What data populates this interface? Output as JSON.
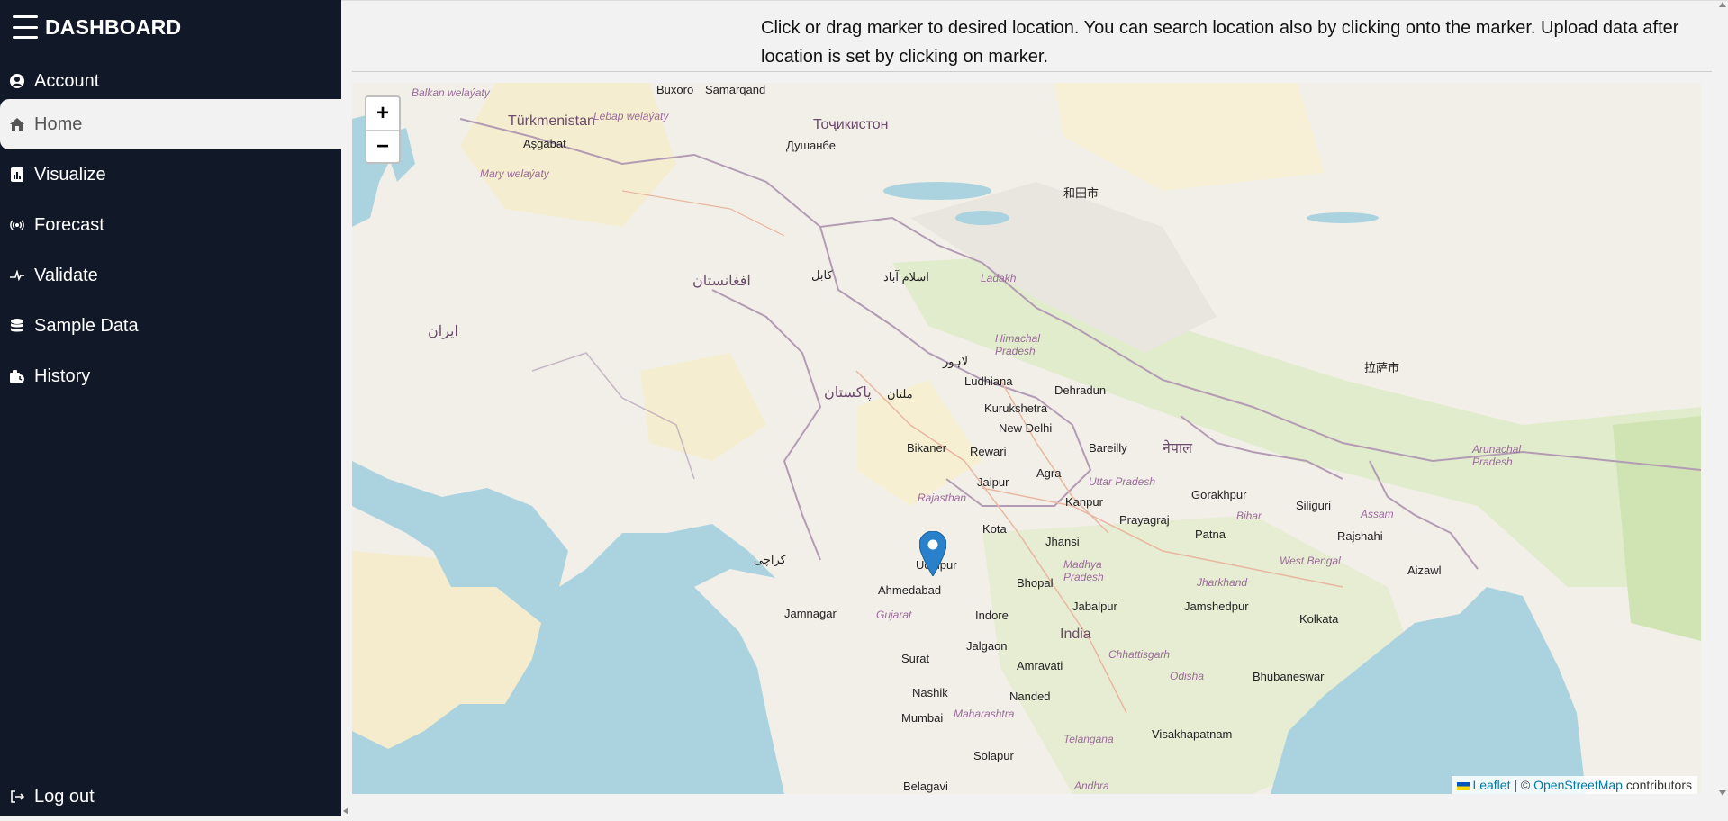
{
  "sidebar": {
    "title": "DASHBOARD",
    "items": [
      {
        "label": "Account",
        "icon": "account-icon"
      },
      {
        "label": "Home",
        "icon": "home-icon",
        "active": true
      },
      {
        "label": "Visualize",
        "icon": "chart-icon"
      },
      {
        "label": "Forecast",
        "icon": "broadcast-icon"
      },
      {
        "label": "Validate",
        "icon": "validate-icon"
      },
      {
        "label": "Sample Data",
        "icon": "database-icon"
      },
      {
        "label": "History",
        "icon": "history-icon"
      }
    ],
    "logout_label": "Log out"
  },
  "main": {
    "instructions": "Click or drag marker to desired location. You can search location also by clicking onto the marker. Upload data after location is set by clicking on marker."
  },
  "map": {
    "zoom_in": "+",
    "zoom_out": "−",
    "attribution": {
      "leaflet": "Leaflet",
      "separator": " | © ",
      "osm": "OpenStreetMap",
      "contributors": " contributors"
    },
    "labels": [
      "Türkmenistan",
      "Aşgabat",
      "Samarqand",
      "Buxoro",
      "Тоҷикистон",
      "Душанбе",
      "افغانستان",
      "کابل",
      "اسلام آباد",
      "پاکستان",
      "ایران",
      "Ladakh",
      "Himachal Pradesh",
      "Ludhiana",
      "Dehradun",
      "Kurukshetra",
      "New Delhi",
      "Bikaner",
      "Rewari",
      "Bareilly",
      "नेपाल",
      "Jaipur",
      "Agra",
      "Uttar Pradesh",
      "Rajasthan",
      "Kanpur",
      "Prayagraj",
      "Gorakhpur",
      "Patna",
      "Bihar",
      "Siliguri",
      "Kota",
      "Jhansi",
      "Udaipur",
      "Ahmedabad",
      "Bhopal",
      "Madhya Pradesh",
      "Jamnagar",
      "Gujarat",
      "Indore",
      "Jabalpur",
      "India",
      "Jamshedpur",
      "Jharkhand",
      "Kolkata",
      "West Bengal",
      "Surat",
      "Jalgaon",
      "Amravati",
      "Chhattisgarh",
      "Nashik",
      "Nanded",
      "Odisha",
      "Bhubaneswar",
      "Mumbai",
      "Maharashtra",
      "Telangana",
      "Visakhapatnam",
      "Solapur",
      "Belagavi",
      "Andhra",
      "Arunachal Pradesh",
      "Assam",
      "Aizawl",
      "Rajshahi",
      "和田市",
      "拉萨市",
      "Mary welaýaty",
      "Lebap welaýaty",
      "Balkan welaýaty",
      "کراچی",
      "ملتان",
      "لاہور",
      "Mumbai"
    ]
  },
  "colors": {
    "sidebar_bg": "#111827",
    "active_bg": "#f2f2f2",
    "marker": "#2a81cb",
    "link": "#0078a8"
  }
}
